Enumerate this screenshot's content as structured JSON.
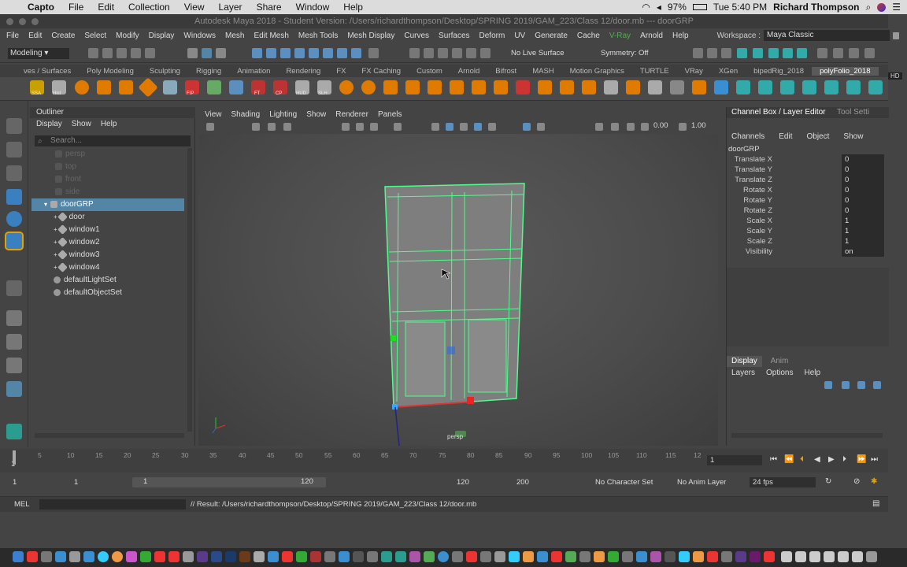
{
  "mac_menubar": {
    "app": "Capto",
    "items": [
      "File",
      "Edit",
      "Collection",
      "View",
      "Layer",
      "Share",
      "Window",
      "Help"
    ],
    "battery": "97%",
    "clock": "Tue 5:40 PM",
    "user": "Richard Thompson"
  },
  "window": {
    "title": "Autodesk Maya 2018 - Student Version: /Users/richardthompson/Desktop/SPRING 2019/GAM_223/Class 12/door.mb  ---  doorGRP"
  },
  "maya_menus": [
    "File",
    "Edit",
    "Create",
    "Select",
    "Modify",
    "Display",
    "Windows",
    "Mesh",
    "Edit Mesh",
    "Mesh Tools",
    "Mesh Display",
    "Curves",
    "Surfaces",
    "Deform",
    "UV",
    "Generate",
    "Cache",
    "V-Ray",
    "Arnold",
    "Help"
  ],
  "workspace": {
    "label": "Workspace :",
    "value": "Maya Classic"
  },
  "statusline": {
    "mode": "Modeling",
    "live_surface": "No Live Surface",
    "symmetry": "Symmetry: Off"
  },
  "shelf": {
    "tabs": [
      "ves / Surfaces",
      "Poly Modeling",
      "Sculpting",
      "Rigging",
      "Animation",
      "Rendering",
      "FX",
      "FX Caching",
      "Custom",
      "Arnold",
      "Bifrost",
      "MASH",
      "Motion Graphics",
      "TURTLE",
      "VRay",
      "XGen",
      "bipedRig_2018",
      "polyFolio_2018"
    ],
    "active_tab": "polyFolio_2018",
    "labels": [
      "SSA",
      "Hist",
      "FT",
      "CP",
      "HUD",
      "SLH",
      "FIP"
    ],
    "hd": "HD"
  },
  "outliner": {
    "title": "Outliner",
    "menu": [
      "Display",
      "Show",
      "Help"
    ],
    "search_placeholder": "Search...",
    "rows": [
      {
        "label": "persp",
        "dim": true
      },
      {
        "label": "top",
        "dim": true
      },
      {
        "label": "front",
        "dim": true
      },
      {
        "label": "side",
        "dim": true
      },
      {
        "label": "doorGRP",
        "selected": true
      },
      {
        "label": "door"
      },
      {
        "label": "window1"
      },
      {
        "label": "window2"
      },
      {
        "label": "window3"
      },
      {
        "label": "window4"
      },
      {
        "label": "defaultLightSet"
      },
      {
        "label": "defaultObjectSet"
      }
    ]
  },
  "viewport": {
    "menu": [
      "View",
      "Shading",
      "Lighting",
      "Show",
      "Renderer",
      "Panels"
    ],
    "value1": "0.00",
    "value2": "1.00",
    "camera_label": "persp"
  },
  "channel_box": {
    "tabs": [
      "Channel Box / Layer Editor",
      "Tool Setti"
    ],
    "menu": [
      "Channels",
      "Edit",
      "Object",
      "Show"
    ],
    "object": "doorGRP",
    "attributes": [
      {
        "name": "Translate X",
        "value": "0"
      },
      {
        "name": "Translate Y",
        "value": "0"
      },
      {
        "name": "Translate Z",
        "value": "0"
      },
      {
        "name": "Rotate X",
        "value": "0"
      },
      {
        "name": "Rotate Y",
        "value": "0"
      },
      {
        "name": "Rotate Z",
        "value": "0"
      },
      {
        "name": "Scale X",
        "value": "1"
      },
      {
        "name": "Scale Y",
        "value": "1"
      },
      {
        "name": "Scale Z",
        "value": "1"
      },
      {
        "name": "Visibility",
        "value": "on"
      }
    ],
    "layer_tabs": [
      "Display",
      "Anim"
    ],
    "layer_menu": [
      "Layers",
      "Options",
      "Help"
    ]
  },
  "timeslider": {
    "ticks": [
      "1",
      "5",
      "10",
      "15",
      "20",
      "25",
      "30",
      "35",
      "40",
      "45",
      "50",
      "55",
      "60",
      "65",
      "70",
      "75",
      "80",
      "85",
      "90",
      "95",
      "100",
      "105",
      "110",
      "115",
      "12"
    ],
    "current": "1",
    "frame_field": "1"
  },
  "range": {
    "start": "1",
    "start2": "1",
    "slider_start": "1",
    "slider_end": "120",
    "end": "120",
    "end2": "200",
    "character_set": "No Character Set",
    "anim_layer": "No Anim Layer",
    "fps": "24 fps"
  },
  "commandline": {
    "language": "MEL",
    "result": "// Result: /Users/richardthompson/Desktop/SPRING 2019/GAM_223/Class 12/door.mb"
  }
}
